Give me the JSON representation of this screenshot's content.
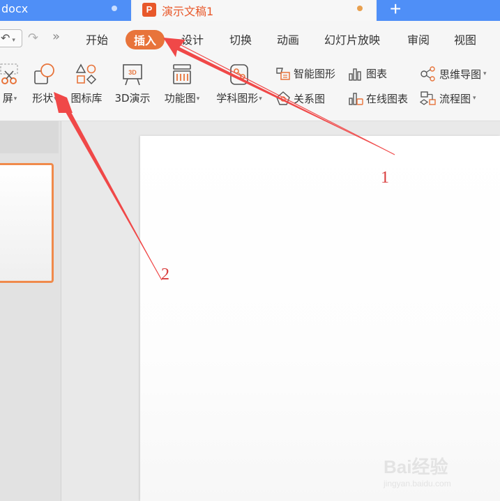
{
  "tabs": [
    {
      "label": "docx"
    },
    {
      "label": "演示文稿1",
      "icon": "presentation-logo-icon",
      "logo_letter": "P"
    },
    {
      "label": "+"
    }
  ],
  "menu": {
    "undo": "↶",
    "redo": "↷",
    "more": "»",
    "items": [
      "开始",
      "插入",
      "设计",
      "切换",
      "动画",
      "幻灯片放映",
      "审阅",
      "视图"
    ],
    "active": "插入"
  },
  "ribbon": {
    "screenshot": "屏",
    "shape": "形状",
    "icon_library": "图标库",
    "threed": "3D演示",
    "function_chart": "功能图",
    "subject_chart": "学科图形",
    "smart_art": "智能图形",
    "chart": "图表",
    "mind_map": "思维导图",
    "relation": "关系图",
    "online_chart": "在线图表",
    "flowchart": "流程图"
  },
  "annotations": {
    "one": "1",
    "two": "2"
  },
  "watermark": {
    "brand": "Bai经验",
    "url": "jingyan.baidu.com"
  },
  "colors": {
    "accent": "#e8743b",
    "tab_blue": "#4f8ff7",
    "arrow": "#f04848"
  }
}
